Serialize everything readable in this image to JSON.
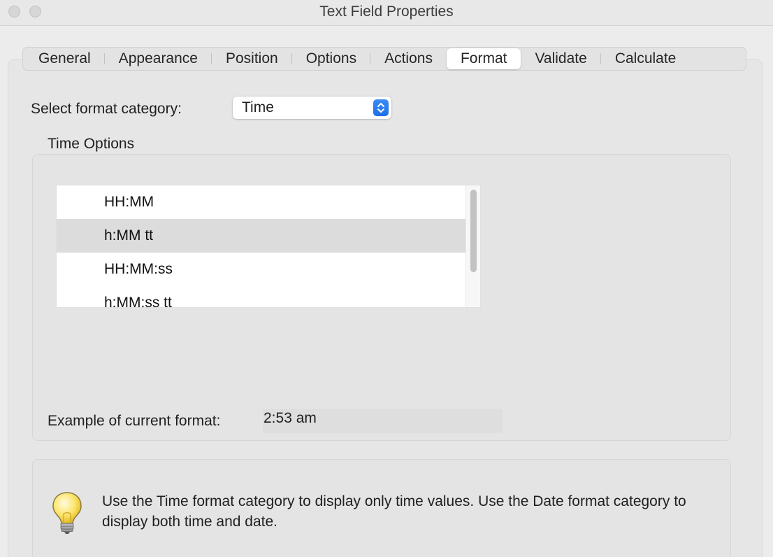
{
  "window": {
    "title": "Text Field Properties"
  },
  "tabs": [
    {
      "label": "General",
      "active": false
    },
    {
      "label": "Appearance",
      "active": false
    },
    {
      "label": "Position",
      "active": false
    },
    {
      "label": "Options",
      "active": false
    },
    {
      "label": "Actions",
      "active": false
    },
    {
      "label": "Format",
      "active": true
    },
    {
      "label": "Validate",
      "active": false
    },
    {
      "label": "Calculate",
      "active": false
    }
  ],
  "format": {
    "category_label": "Select format category:",
    "category_value": "Time"
  },
  "time_options": {
    "group_label": "Time Options",
    "items": [
      {
        "label": "HH:MM",
        "selected": false
      },
      {
        "label": "h:MM tt",
        "selected": true
      },
      {
        "label": "HH:MM:ss",
        "selected": false
      },
      {
        "label": "h:MM:ss tt",
        "selected": false
      }
    ],
    "example_label": "Example of current format:",
    "example_value": "2:53 am"
  },
  "hint": {
    "icon": "lightbulb-icon",
    "text": "Use the Time format category to display only time values. Use the Date format category to display both time and date."
  },
  "colors": {
    "accent": "#1d6fe8",
    "selected_row": "#dcdcdc",
    "window_bg": "#ececec"
  }
}
